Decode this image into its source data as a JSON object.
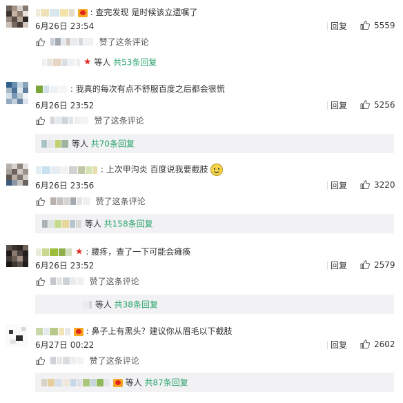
{
  "comments": [
    {
      "text": "查完发现 是时候该立遗嘱了",
      "time": "6月26日 23:54",
      "reply_label": "回复",
      "likes": "5559",
      "praised_label": "赞了这条评论",
      "sub_etc": "等人",
      "sub_total": "共53条回复"
    },
    {
      "text": "我真的每次有点不舒服百度之后都会很慌",
      "time": "6月26日 23:52",
      "reply_label": "回复",
      "likes": "5256",
      "praised_label": "赞了这条评论",
      "sub_etc": "等人",
      "sub_total": "共70条回复"
    },
    {
      "text": "上次甲沟炎 百度说我要截肢",
      "time": "6月26日 23:56",
      "reply_label": "回复",
      "likes": "3220",
      "praised_label": "赞了这条评论",
      "sub_etc": "等人",
      "sub_total": "共158条回复"
    },
    {
      "text": "腰疼，查了一下可能会瘫痪",
      "time": "6月26日 23:52",
      "reply_label": "回复",
      "likes": "2579",
      "praised_label": "赞了这条评论",
      "sub_etc": "等人",
      "sub_total": "共38条回复"
    },
    {
      "text": "鼻子上有黑头？建议你从眉毛以下截肢",
      "time": "6月27日 00:22",
      "reply_label": "回复",
      "likes": "2602",
      "praised_label": "赞了这条评论",
      "sub_etc": "等人",
      "sub_total": "共87条回复"
    }
  ],
  "colors": {
    "link_green": "#2aa36b",
    "sub_bg": "#f2f2f5",
    "text": "#333333"
  },
  "icons": {
    "like": "thumbs-up-icon",
    "vip": "vip-badge-icon",
    "star": "red-star-icon",
    "emoji": "smile-emoji-icon"
  }
}
